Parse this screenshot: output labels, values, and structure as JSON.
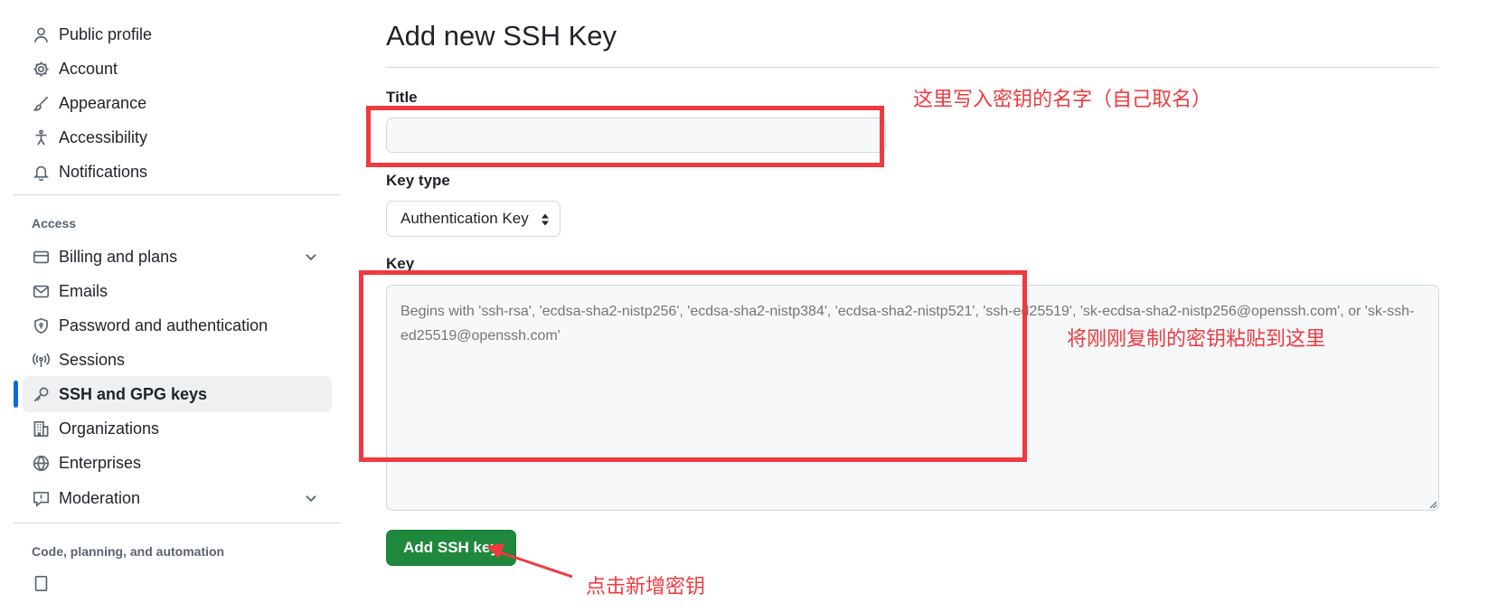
{
  "sidebar": {
    "items_top": [
      {
        "label": "Public profile",
        "icon": "person-icon"
      },
      {
        "label": "Account",
        "icon": "gear-icon"
      },
      {
        "label": "Appearance",
        "icon": "paintbrush-icon"
      },
      {
        "label": "Accessibility",
        "icon": "accessibility-icon"
      },
      {
        "label": "Notifications",
        "icon": "bell-icon"
      }
    ],
    "access_heading": "Access",
    "items_access": [
      {
        "label": "Billing and plans",
        "icon": "credit-card-icon",
        "expandable": true
      },
      {
        "label": "Emails",
        "icon": "mail-icon"
      },
      {
        "label": "Password and authentication",
        "icon": "shield-lock-icon"
      },
      {
        "label": "Sessions",
        "icon": "broadcast-icon"
      },
      {
        "label": "SSH and GPG keys",
        "icon": "key-icon",
        "active": true
      },
      {
        "label": "Organizations",
        "icon": "organization-icon"
      },
      {
        "label": "Enterprises",
        "icon": "globe-icon"
      },
      {
        "label": "Moderation",
        "icon": "report-icon",
        "expandable": true
      }
    ],
    "code_heading": "Code, planning, and automation"
  },
  "main": {
    "title": "Add new SSH Key",
    "title_field": {
      "label": "Title",
      "value": ""
    },
    "key_type": {
      "label": "Key type",
      "selected": "Authentication Key"
    },
    "key_field": {
      "label": "Key",
      "placeholder": "Begins with 'ssh-rsa', 'ecdsa-sha2-nistp256', 'ecdsa-sha2-nistp384', 'ecdsa-sha2-nistp521', 'ssh-ed25519', 'sk-ecdsa-sha2-nistp256@openssh.com', or 'sk-ssh-ed25519@openssh.com'"
    },
    "submit_label": "Add SSH key"
  },
  "annotations": {
    "title_note": "这里写入密钥的名字（自己取名）",
    "key_note": "将刚刚复制的密钥粘贴到这里",
    "button_note": "点击新增密钥"
  },
  "colors": {
    "accent": "#0969da",
    "primary_button": "#1f883d",
    "annotation": "#ef3a3f"
  }
}
